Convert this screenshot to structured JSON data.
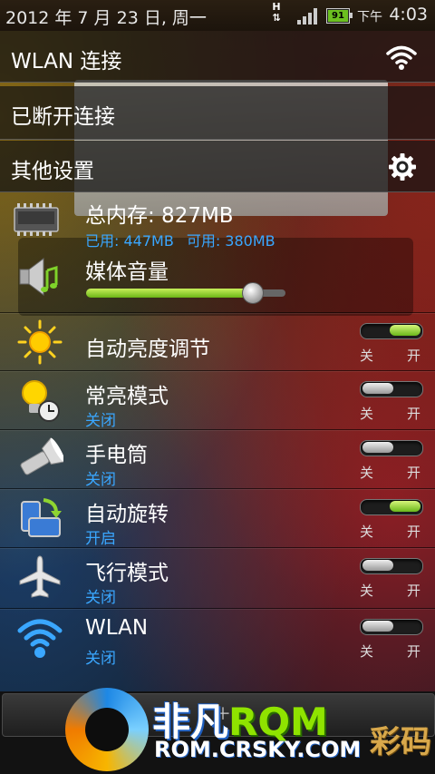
{
  "status_bar": {
    "date": "2012 年 7 月 23 日, 周一",
    "network_type": "H",
    "battery_level": "91",
    "ampm": "下午",
    "time": "4:03"
  },
  "header_rows": {
    "wlan_connect": "WLAN 连接",
    "disconnected": "已断开连接",
    "other_settings": "其他设置"
  },
  "memory": {
    "total": "总内存: 827MB",
    "used": "已用: 447MB",
    "available": "可用: 380MB"
  },
  "media_volume": {
    "label": "媒体音量",
    "level": 0.83
  },
  "toggles": [
    {
      "label": "自动亮度调节",
      "status": "",
      "state": "on",
      "icon": "sun-icon"
    },
    {
      "label": "常亮模式",
      "status": "关闭",
      "state": "off",
      "icon": "bulb-clock-icon"
    },
    {
      "label": "手电筒",
      "status": "关闭",
      "state": "off",
      "icon": "flashlight-icon"
    },
    {
      "label": "自动旋转",
      "status": "开启",
      "state": "on",
      "icon": "rotate-icon"
    },
    {
      "label": "飞行模式",
      "status": "关闭",
      "state": "off",
      "icon": "airplane-icon"
    },
    {
      "label": "WLAN",
      "status": "关闭",
      "state": "off",
      "icon": "wifi-icon"
    }
  ],
  "toggle_labels": {
    "off": "关",
    "on": "开"
  },
  "watermark": {
    "line1_a": "非凡",
    "line1_b": "RQM",
    "line2": "ROM.CRSKY.COM",
    "side": "彩码"
  },
  "colors": {
    "accent_blue": "#3aa7ff",
    "toggle_green": "#8fd430"
  }
}
